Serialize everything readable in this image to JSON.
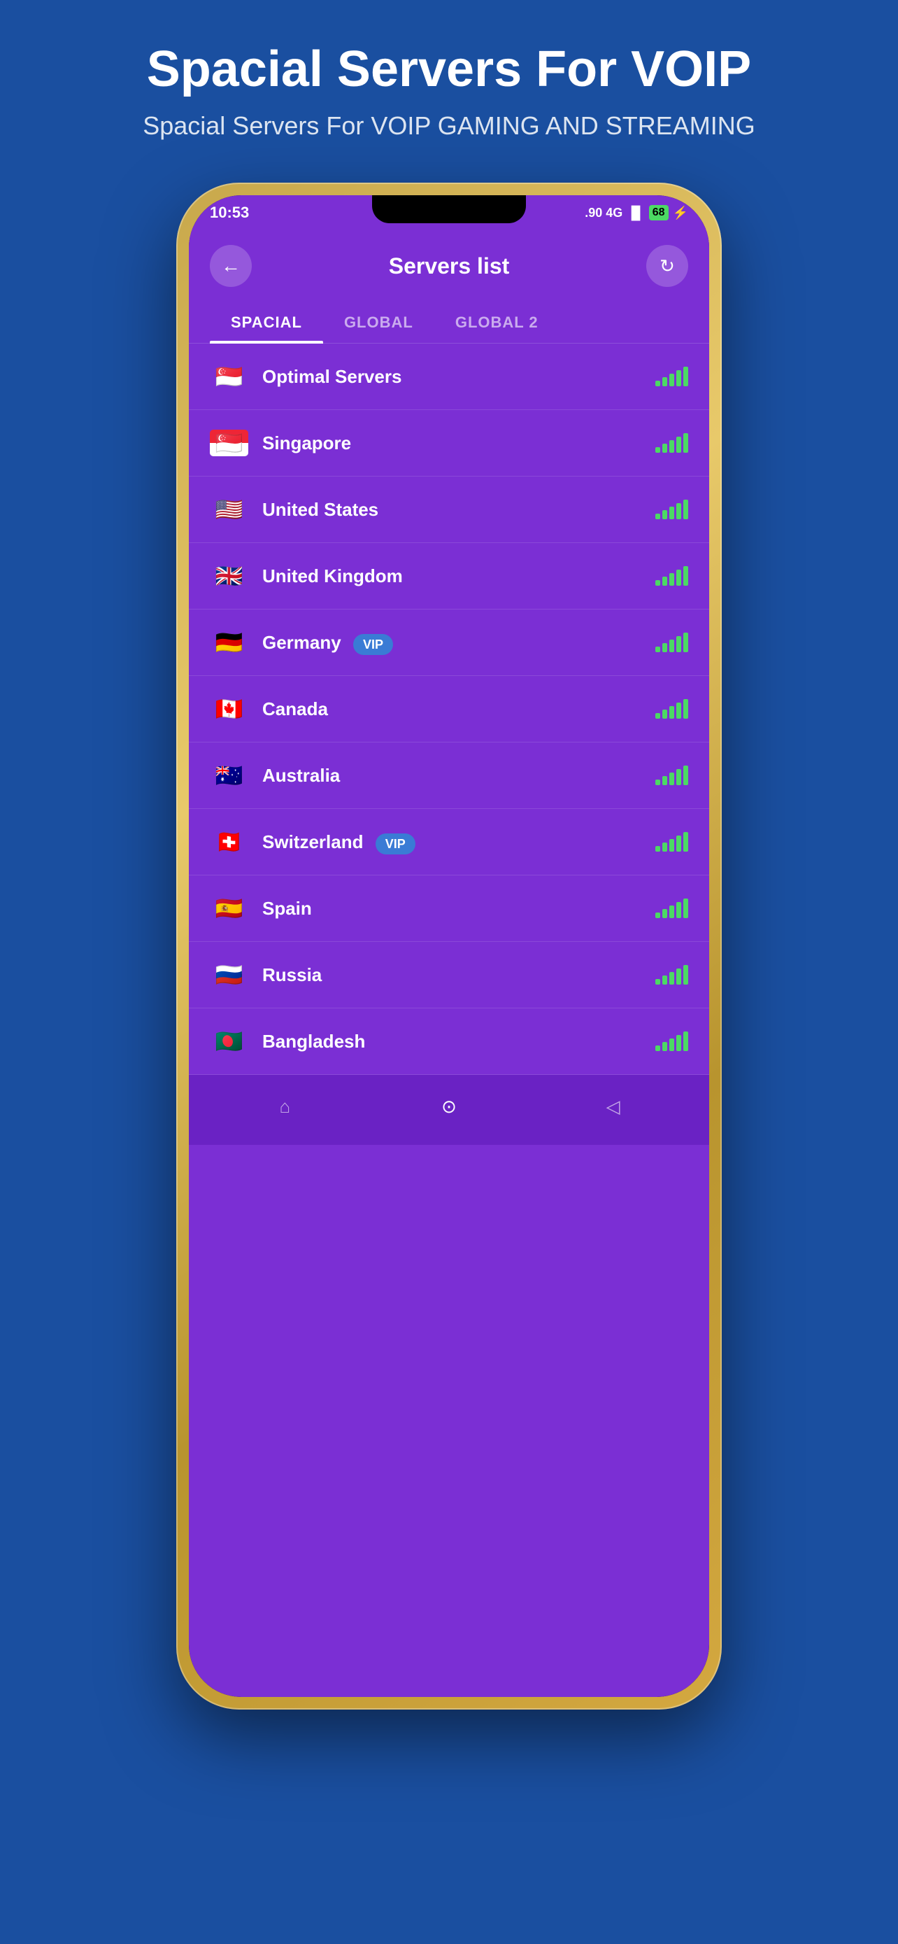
{
  "header": {
    "title": "Spacial Servers For VOIP",
    "subtitle": "Spacial Servers  For VOIP GAMING AND STREAMING"
  },
  "status_bar": {
    "time": "10:53",
    "network": ".90 4G",
    "battery": "68"
  },
  "app": {
    "title": "Servers list",
    "back_label": "←",
    "refresh_label": "↻"
  },
  "tabs": [
    {
      "id": "spacial",
      "label": "SPACIAL",
      "active": true
    },
    {
      "id": "global",
      "label": "GLOBAL",
      "active": false
    },
    {
      "id": "global2",
      "label": "GLOBAL 2",
      "active": false
    }
  ],
  "servers": [
    {
      "id": "optimal",
      "name": "Optimal Servers",
      "flag_class": "flag-opt",
      "vip": false
    },
    {
      "id": "singapore",
      "name": "Singapore",
      "flag_class": "flag-sg",
      "vip": false
    },
    {
      "id": "us",
      "name": "United States",
      "flag_class": "flag-us",
      "vip": false
    },
    {
      "id": "uk",
      "name": "United Kingdom",
      "flag_class": "flag-uk",
      "vip": false
    },
    {
      "id": "germany",
      "name": "Germany",
      "flag_class": "flag-de",
      "vip": true
    },
    {
      "id": "canada",
      "name": "Canada",
      "flag_class": "flag-ca",
      "vip": false
    },
    {
      "id": "australia",
      "name": "Australia",
      "flag_class": "flag-au",
      "vip": false
    },
    {
      "id": "switzerland",
      "name": "Switzerland",
      "flag_class": "flag-ch",
      "vip": true
    },
    {
      "id": "spain",
      "name": "Spain",
      "flag_class": "flag-es",
      "vip": false
    },
    {
      "id": "russia",
      "name": "Russia",
      "flag_class": "flag-ru",
      "vip": false
    },
    {
      "id": "bangladesh",
      "name": "Bangladesh",
      "flag_class": "flag-bd",
      "vip": false
    }
  ],
  "vip_label": "VIP",
  "bottom_nav": [
    {
      "id": "home",
      "icon": "⌂"
    },
    {
      "id": "center",
      "icon": "⊙"
    },
    {
      "id": "back",
      "icon": "◁"
    }
  ]
}
